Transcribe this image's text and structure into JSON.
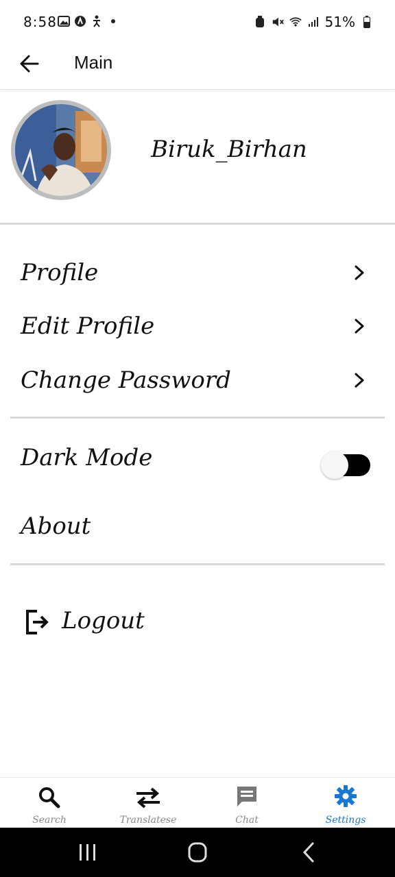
{
  "status_bar": {
    "time": "8:58",
    "battery": "51%"
  },
  "app_bar": {
    "title": "Main"
  },
  "profile": {
    "username": "Biruk_Birhan"
  },
  "menu": {
    "profile": "Profile",
    "edit_profile": "Edit Profile",
    "change_password": "Change Password",
    "dark_mode": "Dark Mode",
    "about": "About",
    "logout": "Logout"
  },
  "dark_mode_enabled": false,
  "bottom_nav": [
    {
      "label": "Search",
      "icon": "search-icon"
    },
    {
      "label": "Translatese",
      "icon": "swap-icon"
    },
    {
      "label": "Chat",
      "icon": "chat-icon"
    },
    {
      "label": "Settings",
      "icon": "gear-icon",
      "active": true
    }
  ],
  "colors": {
    "accent": "#1976d2",
    "toggle_track": "#000000",
    "divider": "#d9d9d9"
  }
}
